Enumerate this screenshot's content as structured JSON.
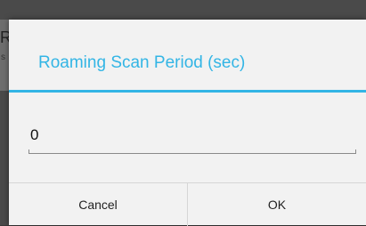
{
  "background": {
    "title_fragment": "Ro",
    "subtitle_fragment": "s"
  },
  "dialog": {
    "title": "Roaming Scan Period (sec)",
    "input_value": "0",
    "buttons": {
      "cancel": "Cancel",
      "ok": "OK"
    }
  },
  "colors": {
    "accent": "#33b5e5",
    "dialog_bg": "#f2f2f2",
    "text": "#222222",
    "divider": "#d6d6d6"
  }
}
